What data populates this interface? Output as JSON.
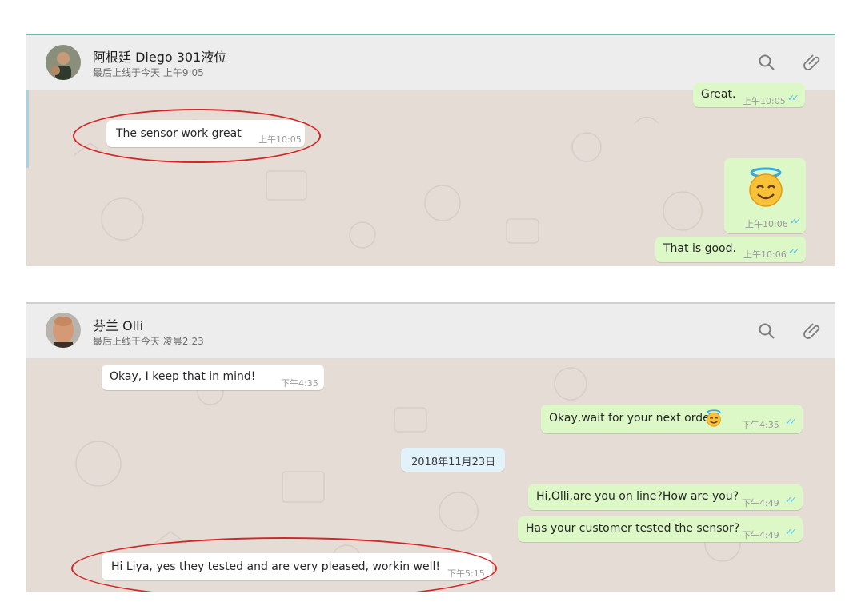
{
  "chat1": {
    "contact_name": "阿根廷 Diego 301液位",
    "last_seen": "最后上线于今天 上午9:05",
    "messages": [
      {
        "text": "Great.",
        "time": "上午10:05",
        "dir": "out"
      },
      {
        "text": "The sensor work great",
        "time": "上午10:05",
        "dir": "in"
      },
      {
        "text": "",
        "time": "上午10:06",
        "dir": "out",
        "emoji": "smiling-face-with-halo"
      },
      {
        "text": "That is good.",
        "time": "上午10:06",
        "dir": "out"
      }
    ]
  },
  "chat2": {
    "contact_name": "芬兰 Olli",
    "last_seen": "最后上线于今天 凌晨2:23",
    "date_separator": "2018年11月23日",
    "messages": [
      {
        "text": "Okay, I keep that in mind!",
        "time": "下午4:35",
        "dir": "in"
      },
      {
        "text": "Okay,wait for your next order.",
        "time": "下午4:35",
        "dir": "out",
        "emoji": "smiling-face-with-halo"
      },
      {
        "text": "Hi,Olli,are you on line?How are you?",
        "time": "下午4:49",
        "dir": "out"
      },
      {
        "text": "Has your customer tested the sensor?",
        "time": "下午4:49",
        "dir": "out"
      },
      {
        "text": "Hi Liya, yes they tested and are very pleased, workin well!",
        "time": "下午5:15",
        "dir": "in"
      }
    ]
  },
  "icons": {
    "search": "search-icon",
    "attach": "paperclip-icon",
    "read_receipt": "double-check-icon"
  },
  "colors": {
    "incoming_bubble": "#ffffff",
    "outgoing_bubble": "#dcf8c6",
    "chat_background": "#e5ddd5",
    "header_background": "#ededed",
    "read_tick": "#4fc3f7",
    "highlight_ring": "#d42626"
  }
}
